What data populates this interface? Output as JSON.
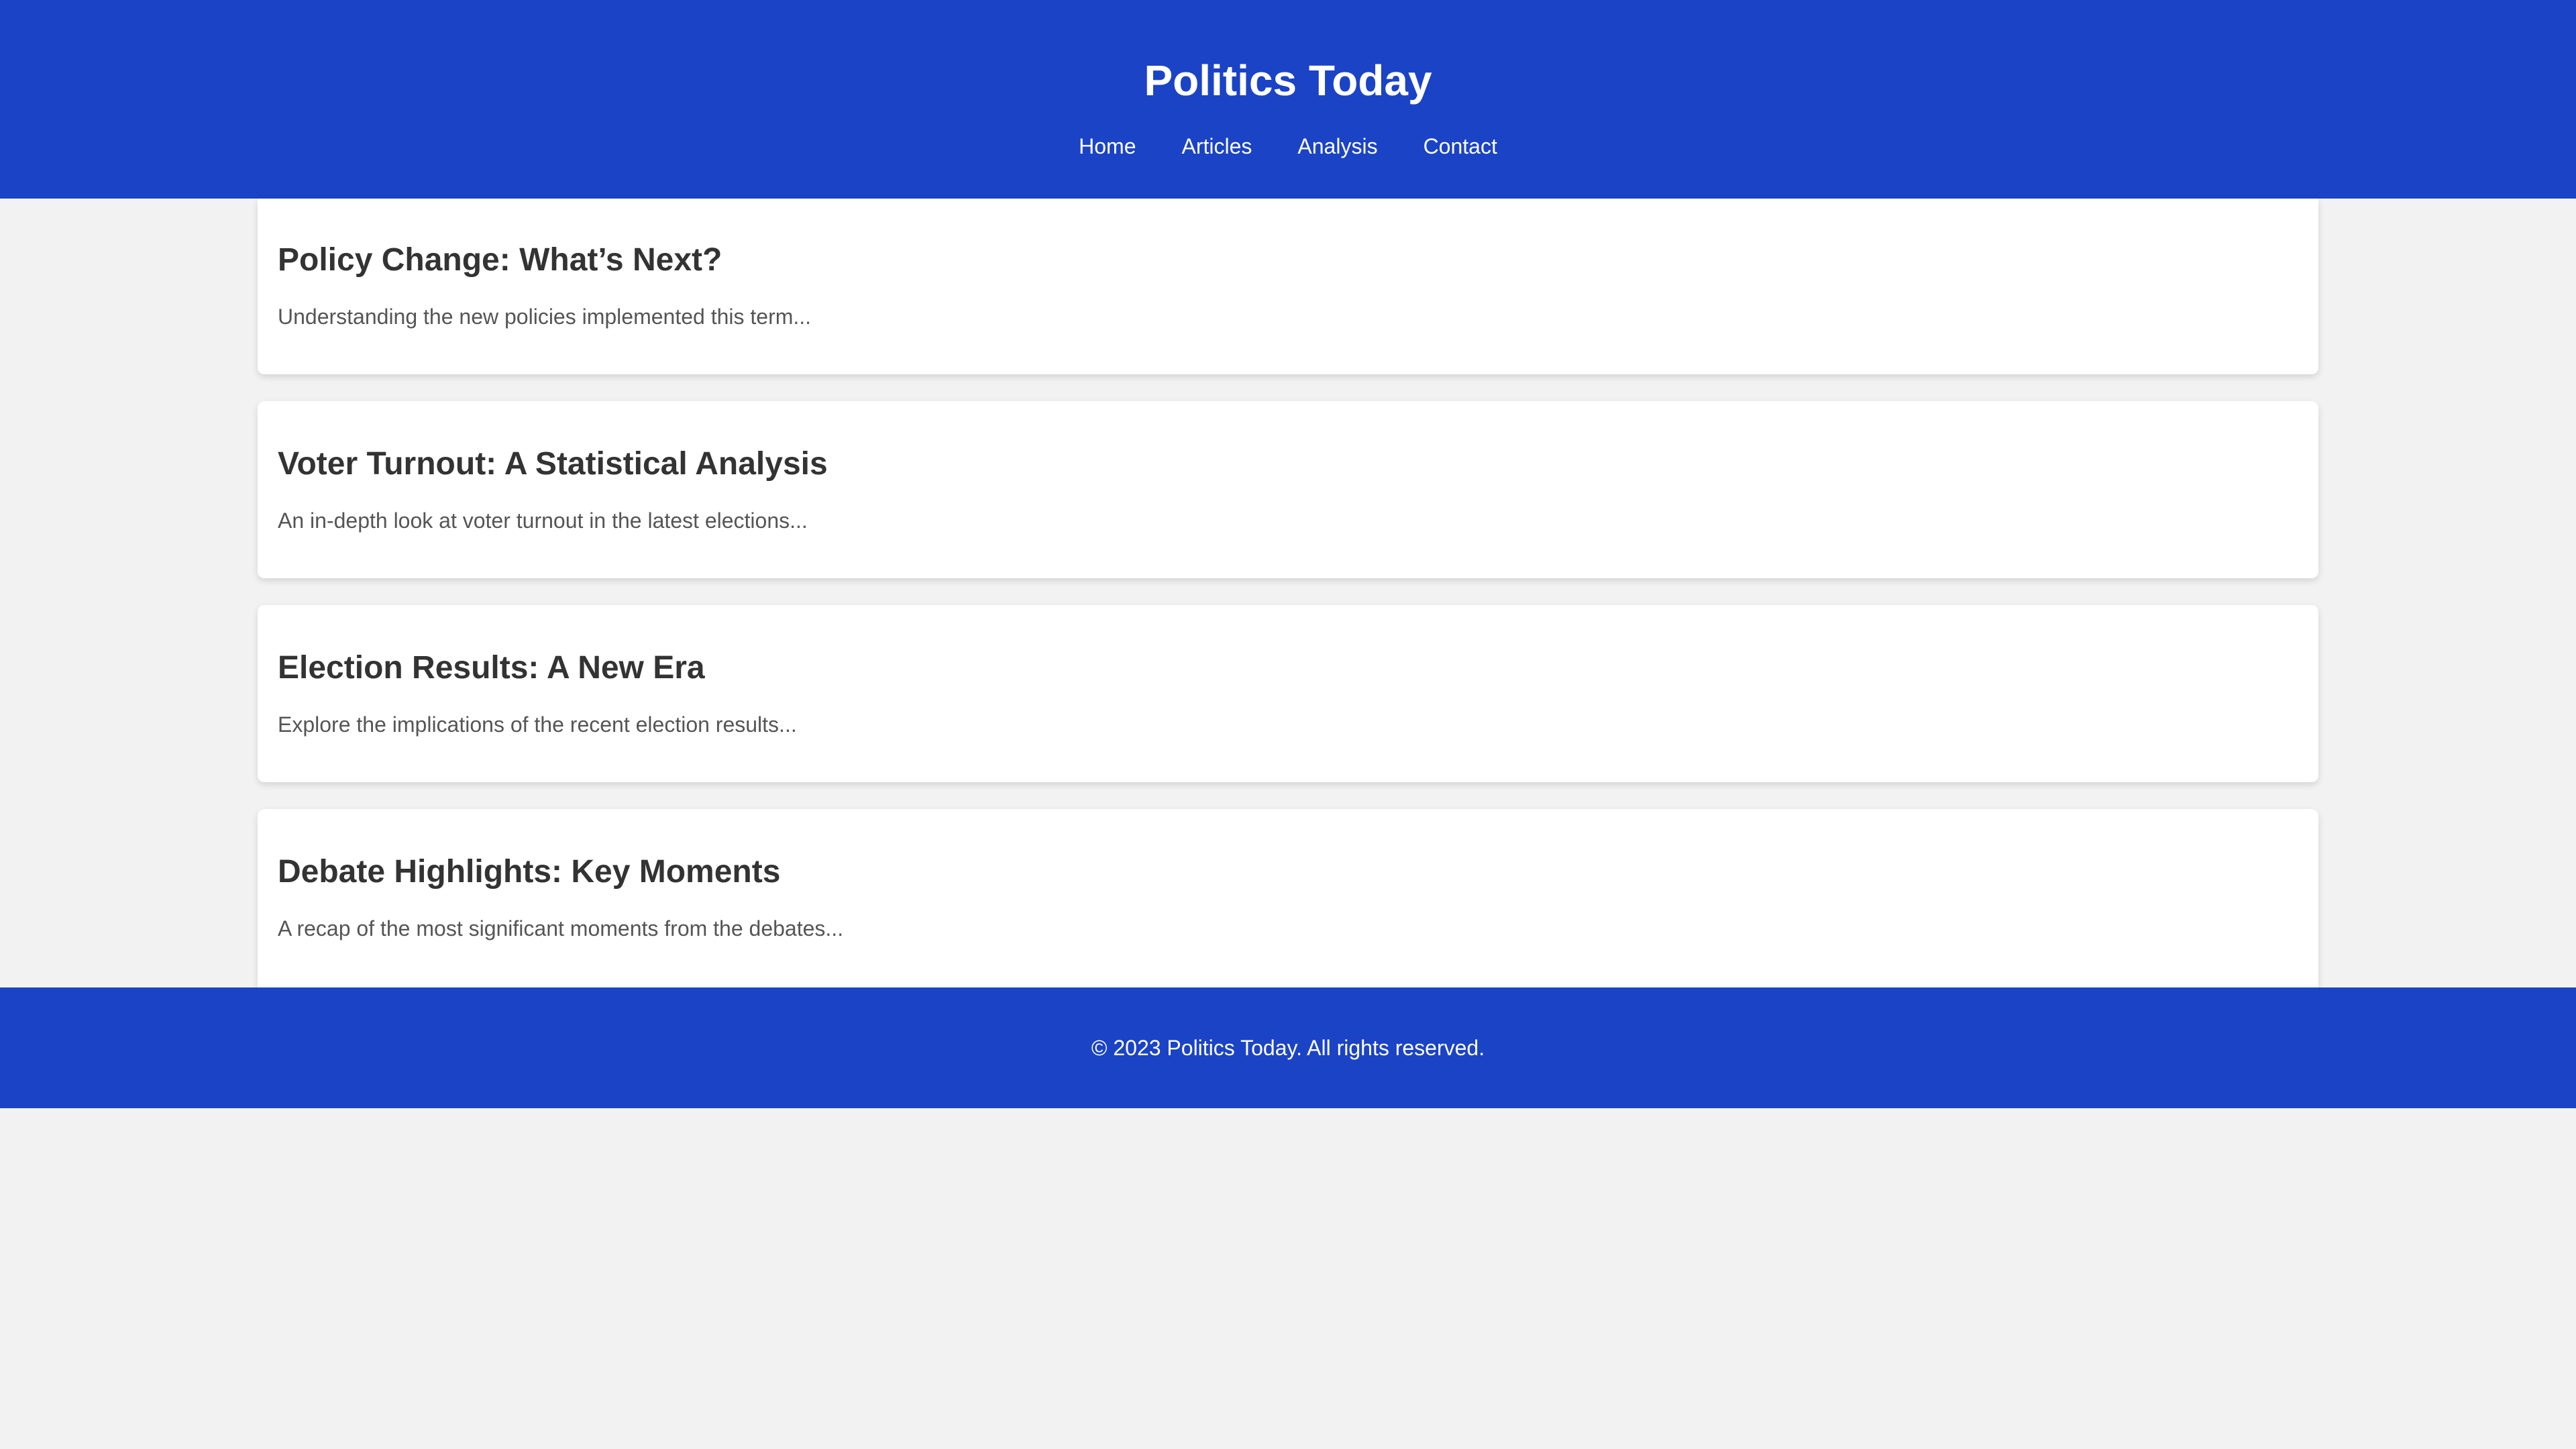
{
  "header": {
    "title": "Politics Today",
    "nav": [
      "Home",
      "Articles",
      "Analysis",
      "Contact"
    ]
  },
  "articles": [
    {
      "title": "Policy Change: What’s Next?",
      "summary": "Understanding the new policies implemented this term..."
    },
    {
      "title": "Voter Turnout: A Statistical Analysis",
      "summary": "An in-depth look at voter turnout in the latest elections..."
    },
    {
      "title": "Election Results: A New Era",
      "summary": "Explore the implications of the recent election results..."
    },
    {
      "title": "Debate Highlights: Key Moments",
      "summary": "A recap of the most significant moments from the debates..."
    }
  ],
  "footer": {
    "text": "© 2023 Politics Today. All rights reserved."
  },
  "colors": {
    "brand": "#1b43c6",
    "page_background": "#f2f2f2",
    "card_background": "#ffffff",
    "title_text": "#333333",
    "summary_text": "#555555"
  }
}
